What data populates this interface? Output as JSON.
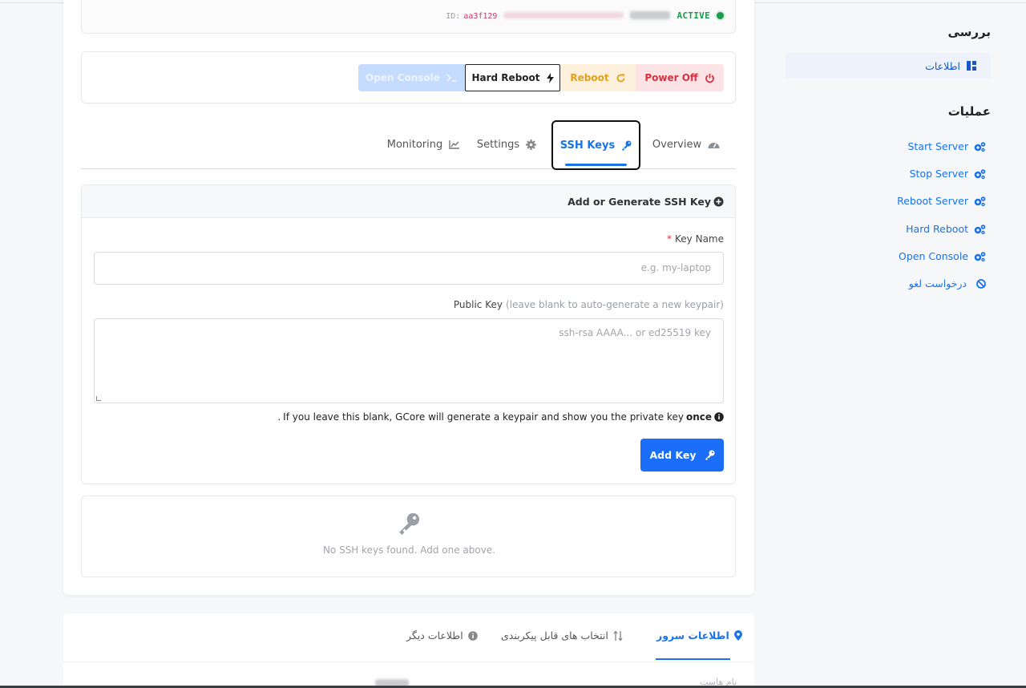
{
  "status": {
    "id_label": "ID:",
    "id_value": "aa3f129",
    "state": "ACTIVE"
  },
  "actions": {
    "power_off": "Power Off",
    "reboot": "Reboot",
    "hard_reboot": "Hard Reboot",
    "open_console": "Open Console"
  },
  "tabs": {
    "overview": "Overview",
    "ssh_keys": "SSH Keys",
    "settings": "Settings",
    "monitoring": "Monitoring"
  },
  "form": {
    "header": "Add or Generate SSH Key",
    "key_name_label": "Key Name",
    "key_name_required": "*",
    "key_name_placeholder": "e.g. my-laptop",
    "public_key_label": "Public Key",
    "public_key_hint": "(leave blank to auto-generate a new keypair)",
    "public_key_placeholder": "ssh-rsa AAAA... or ed25519 key",
    "help_text": "If you leave this blank, GCore will generate a keypair and show you the private key",
    "help_bold": "once",
    "help_period": ".",
    "add_key_button": "Add Key"
  },
  "empty_state": {
    "message": "No SSH keys found. Add one above."
  },
  "bottom": {
    "tab_server_info": "اطلاعات سرور",
    "tab_configurable": "انتخاب های قابل پیکربندی",
    "tab_other_info": "اطلاعات دیگر",
    "hostname_label": "نام هاست"
  },
  "sidebar": {
    "review_heading": "بررسی",
    "info_item": "اطلاعات",
    "operations_heading": "عملیات",
    "items": [
      {
        "label": "Start Server"
      },
      {
        "label": "Stop Server"
      },
      {
        "label": "Reboot Server"
      },
      {
        "label": "Hard Reboot"
      },
      {
        "label": "Open Console"
      },
      {
        "label": "درخواست لغو"
      }
    ]
  },
  "colors": {
    "primary": "#1a73e8",
    "active_green": "#1e9a4f",
    "danger": "#d9303e",
    "warning": "#e5a01a"
  }
}
